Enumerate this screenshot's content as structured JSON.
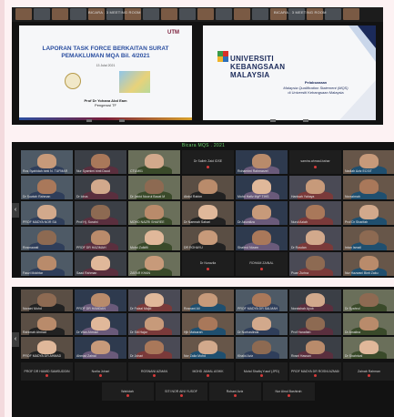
{
  "colors": {
    "page_background": "#fdf2f3",
    "meeting_background": "#121212",
    "gallery_title": "#6bd06b",
    "muted_mic": "#d63a3a",
    "utm_maroon": "#7b1e3a",
    "slide_blue": "#2a4ea0"
  },
  "screenshot1": {
    "strip_title_left": "BICARA . 3 MEETING ROOM",
    "strip_title_right": "BICARA . 3 MEETING ROOM",
    "slide_left": {
      "logo": "UTM",
      "title": "LAPORAN TASK FORCE BERKAITAN SURAT PEMAKLUMAN MQA Bil. 4/2021",
      "subtitle": "13 Julai 2021",
      "presenter_name": "Prof Dr Yohana Abd Eam",
      "presenter_role": "Pengerusi TF"
    },
    "slide_right": {
      "university_line1": "UNIVERSITI",
      "university_line2": "KEBANGSAAN",
      "university_line3": "MALAYSIA",
      "line1": "Pelaksanaan",
      "line2": "Malaysia Qualification Statement (MQS)",
      "line3": "di Universiti Kebangsaan Malaysia"
    },
    "icons": [
      "video-thumbnail",
      "seal-icon",
      "slide-toolbar-icon"
    ]
  },
  "screenshot2": {
    "gallery_title": "Bicara MQS . 2021",
    "tiles": [
      {
        "name": "Ros Syahidah binti N. TUFMAR",
        "video": true
      },
      {
        "name": "Nur Syamimi binti Daud",
        "video": true
      },
      {
        "name": "CTUM01",
        "video": true
      },
      {
        "name": "Dr Salleh Zaid IDSE",
        "video": false
      },
      {
        "name": "Rohamimi Rahmarzel",
        "video": true
      },
      {
        "name": "samira.ahmad-bahar",
        "video": false
      },
      {
        "name": "Nadiah Aziz ECSIT",
        "video": true
      },
      {
        "name": "Dr Suwiah Rahman",
        "video": true
      },
      {
        "name": "Dr Idrus",
        "video": true
      },
      {
        "name": "Dr Jabid Noorul Bacat M",
        "video": true
      },
      {
        "name": "Abdul Rahim",
        "video": true
      },
      {
        "name": "Mohd Hafiz MyP TIHS",
        "video": true
      },
      {
        "name": "Hanisah Yahaya",
        "video": true
      },
      {
        "name": "Norazimah",
        "video": true
      },
      {
        "name": "PROF MADYA NOR SA",
        "video": true
      },
      {
        "name": "Prof Hj. Suraini",
        "video": true
      },
      {
        "name": "MOHD NAZRI SHAREE",
        "video": true
      },
      {
        "name": "Dr Naemah Sahari",
        "video": true
      },
      {
        "name": "Dr Azuraliza",
        "video": true
      },
      {
        "name": "Nurul Aziah",
        "video": true
      },
      {
        "name": "Prof Dr Sharifah",
        "video": true
      },
      {
        "name": "Rosmawati",
        "video": true
      },
      {
        "name": "PROF DR HAZIMAH",
        "video": true
      },
      {
        "name": "Mohd Zulkifli",
        "video": true
      },
      {
        "name": "DR ROHAYU",
        "video": true
      },
      {
        "name": "Shahrul Nizam",
        "video": true
      },
      {
        "name": "Dr Rosdan",
        "video": true
      },
      {
        "name": "Intan Ismail",
        "video": true
      },
      {
        "name": "Fauzi Mokhtar",
        "video": true
      },
      {
        "name": "Saad Rahman",
        "video": true
      },
      {
        "name": "ZAFAR KHAN",
        "video": true
      },
      {
        "name": "Dr Nurazila",
        "video": false
      },
      {
        "name": "ROHAM ZAINAL",
        "video": false
      },
      {
        "name": "Puan Zurina",
        "video": true
      },
      {
        "name": "Nur Hazwani Binti Zaku",
        "video": true
      },
      {
        "name": "Hamidah Azmi",
        "video": true
      }
    ]
  },
  "screenshot3": {
    "tiles_video": [
      {
        "name": "Noraini Mohd"
      },
      {
        "name": "PROF DR HAMDAN"
      },
      {
        "name": "Dr Faizal Majid"
      },
      {
        "name": "Rosnani Ali"
      },
      {
        "name": "PROF MADYA DR SALMAH"
      },
      {
        "name": "Noraishah Ayub"
      },
      {
        "name": "Dr Syahrul"
      },
      {
        "name": "Rahimah Ahmad"
      },
      {
        "name": "Dr Wan Ahmad"
      },
      {
        "name": "Dr Siti Hajar"
      },
      {
        "name": "Hjh Maisarah"
      },
      {
        "name": "Dr Norhaslinda"
      },
      {
        "name": "Prof Hanafiah"
      },
      {
        "name": "Dr Amalina"
      },
      {
        "name": "PROF MADYA DR AHMAD"
      },
      {
        "name": "Ahmad Zainal"
      },
      {
        "name": "Dr Johari"
      },
      {
        "name": "Nor Zaila Mohd"
      },
      {
        "name": "Khalid Aziz"
      },
      {
        "name": "Rosni Hassan"
      },
      {
        "name": "Dr Shahrizal"
      },
      {
        "name": "Puan Fatimah"
      },
      {
        "name": "Dr Rahman Taib"
      },
      {
        "name": "Salmi Ismail"
      }
    ],
    "tiles_audio": [
      {
        "name": "PROF DR HAMID SAMSUDDIN"
      },
      {
        "name": "Norlia Johari"
      },
      {
        "name": "ROSNANI AZMAN"
      },
      {
        "name": "MOHD JAMAL ASHIK"
      },
      {
        "name": "Mohd Shafiq Yusof (JPD)"
      },
      {
        "name": "PROF MADYA DR ROSNI AZMAN"
      },
      {
        "name": "Zainab Rahman"
      },
      {
        "name": "Wahidah"
      },
      {
        "name": "SITI NOR AINI YUSOF"
      },
      {
        "name": "Rohani Aziz"
      },
      {
        "name": "Nur Ainul Bashirah"
      }
    ]
  }
}
